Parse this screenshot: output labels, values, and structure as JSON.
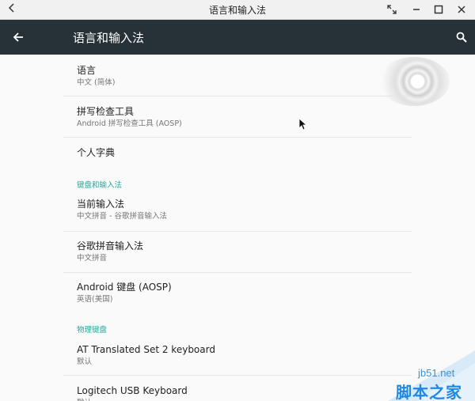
{
  "window": {
    "title": "语言和输入法"
  },
  "appbar": {
    "title": "语言和输入法"
  },
  "list": {
    "language": {
      "title": "语言",
      "subtitle": "中文 (简体)"
    },
    "spell_checker": {
      "title": "拼写检查工具",
      "subtitle": "Android 拼写检查工具 (AOSP)"
    },
    "personal_dictionary": {
      "title": "个人字典"
    },
    "section_keyboard": "键盘和输入法",
    "current_ime": {
      "title": "当前输入法",
      "subtitle": "中文拼音 - 谷歌拼音输入法"
    },
    "google_pinyin": {
      "title": "谷歌拼音输入法",
      "subtitle": "中文拼音"
    },
    "android_keyboard": {
      "title": "Android 键盘 (AOSP)",
      "subtitle": "英语(美国)"
    },
    "section_physical": "物理键盘",
    "at_keyboard": {
      "title": "AT Translated Set 2 keyboard",
      "subtitle": "默认"
    },
    "logitech_keyboard": {
      "title": "Logitech USB Keyboard",
      "subtitle": "默认"
    }
  },
  "watermark": {
    "site": "jb51.net",
    "name": "脚本之家"
  },
  "colors": {
    "appbar": "#263238",
    "accent": "#26a69a",
    "watermark": "#1e88e5"
  },
  "icons": [
    "chevron-left-icon",
    "maximize-restore-icon",
    "minimize-icon",
    "maximize-icon",
    "close-icon",
    "arrow-back-icon",
    "search-icon",
    "mouse-cursor-icon"
  ]
}
